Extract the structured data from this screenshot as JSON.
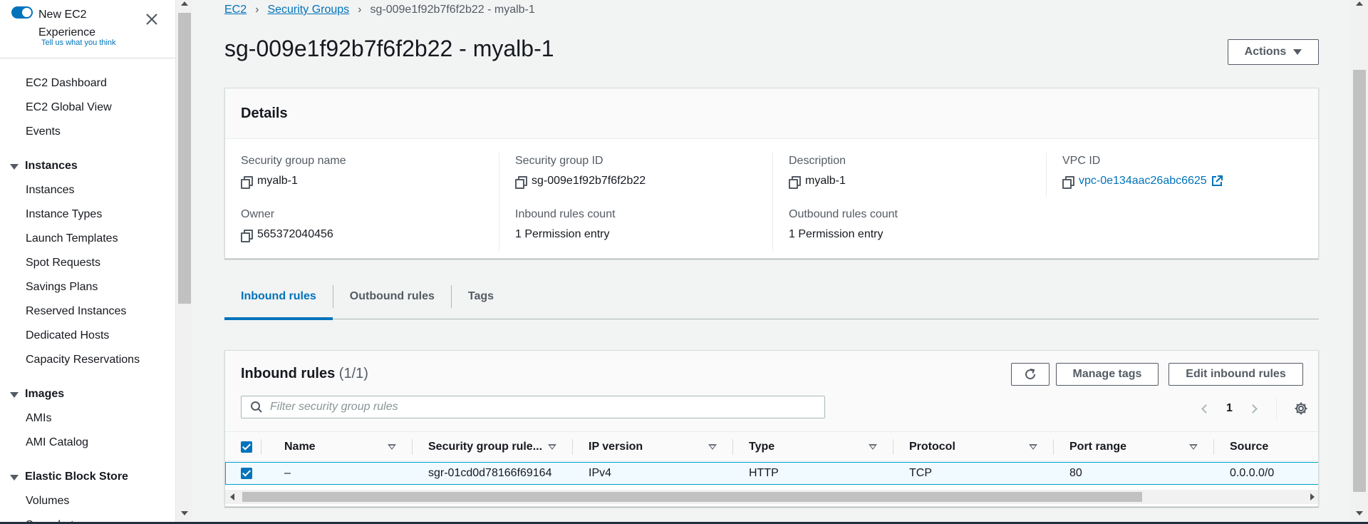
{
  "sidebar": {
    "toggle_label": "New EC2 Experience",
    "toggle_sublink": "Tell us what you think",
    "items_top": [
      "EC2 Dashboard",
      "EC2 Global View",
      "Events"
    ],
    "section_instances": {
      "title": "Instances",
      "items": [
        "Instances",
        "Instance Types",
        "Launch Templates",
        "Spot Requests",
        "Savings Plans",
        "Reserved Instances",
        "Dedicated Hosts",
        "Capacity Reservations"
      ]
    },
    "section_images": {
      "title": "Images",
      "items": [
        "AMIs",
        "AMI Catalog"
      ]
    },
    "section_ebs": {
      "title": "Elastic Block Store",
      "items": [
        "Volumes",
        "Snapshots"
      ]
    }
  },
  "breadcrumb": {
    "items": [
      "EC2",
      "Security Groups"
    ],
    "current": "sg-009e1f92b7f6f2b22 - myalb-1"
  },
  "page": {
    "title": "sg-009e1f92b7f6f2b22 - myalb-1",
    "actions_label": "Actions"
  },
  "details": {
    "heading": "Details",
    "fields": [
      {
        "label": "Security group name",
        "value": "myalb-1"
      },
      {
        "label": "Security group ID",
        "value": "sg-009e1f92b7f6f2b22"
      },
      {
        "label": "Description",
        "value": "myalb-1"
      },
      {
        "label": "VPC ID",
        "value": "vpc-0e134aac26abc6625"
      },
      {
        "label": "Owner",
        "value": "565372040456"
      },
      {
        "label": "Inbound rules count",
        "value": "1 Permission entry"
      },
      {
        "label": "Outbound rules count",
        "value": "1 Permission entry"
      }
    ]
  },
  "tabs": [
    "Inbound rules",
    "Outbound rules",
    "Tags"
  ],
  "inbound": {
    "title": "Inbound rules",
    "count": "(1/1)",
    "manage_tags_label": "Manage tags",
    "edit_label": "Edit inbound rules",
    "search_placeholder": "Filter security group rules",
    "page": "1",
    "columns": [
      "Name",
      "Security group rule...",
      "IP version",
      "Type",
      "Protocol",
      "Port range",
      "Source"
    ],
    "rows": [
      [
        "–",
        "sgr-01cd0d78166f69164",
        "IPv4",
        "HTTP",
        "TCP",
        "80",
        "0.0.0.0/0"
      ]
    ]
  },
  "colors": {
    "link": "#0073bb",
    "selected_row_bg": "#f1faff",
    "selected_row_border": "#00a1c9"
  }
}
